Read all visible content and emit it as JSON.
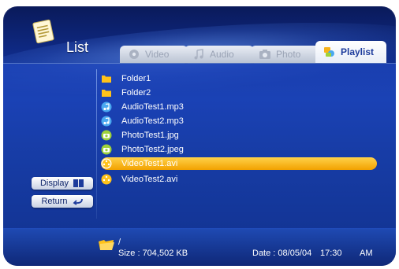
{
  "header": {
    "title": "List"
  },
  "tabs": [
    {
      "label": "Video",
      "icon": "video-icon"
    },
    {
      "label": "Audio",
      "icon": "music-note-icon"
    },
    {
      "label": "Photo",
      "icon": "camera-icon"
    },
    {
      "label": "Playlist",
      "icon": "playlist-icon",
      "active": true
    }
  ],
  "files": [
    {
      "name": "Folder1",
      "type": "folder"
    },
    {
      "name": "Folder2",
      "type": "folder"
    },
    {
      "name": "AudioTest1.mp3",
      "type": "audio"
    },
    {
      "name": "AudioTest2.mp3",
      "type": "audio"
    },
    {
      "name": "PhotoTest1.jpg",
      "type": "photo"
    },
    {
      "name": "PhotoTest2.jpeg",
      "type": "photo"
    },
    {
      "name": "VideoTest1.avi",
      "type": "video",
      "selected": true
    },
    {
      "name": "VideoTest2.avi",
      "type": "video"
    }
  ],
  "side_buttons": {
    "display_label": "Display",
    "return_label": "Return"
  },
  "status": {
    "path": "/",
    "size": "Size : 704,502 KB",
    "date": "Date : 08/05/04",
    "time": "17:30",
    "ampm": "AM"
  },
  "colors": {
    "background_top": "#0a1a5a",
    "background_mid": "#173fae",
    "selection": "#f7b21a",
    "folder": "#ffc21a",
    "audio": "#4aa8f0",
    "photo": "#9ed23a",
    "video": "#ffc21a",
    "active_tab_text": "#1d3b9c"
  }
}
